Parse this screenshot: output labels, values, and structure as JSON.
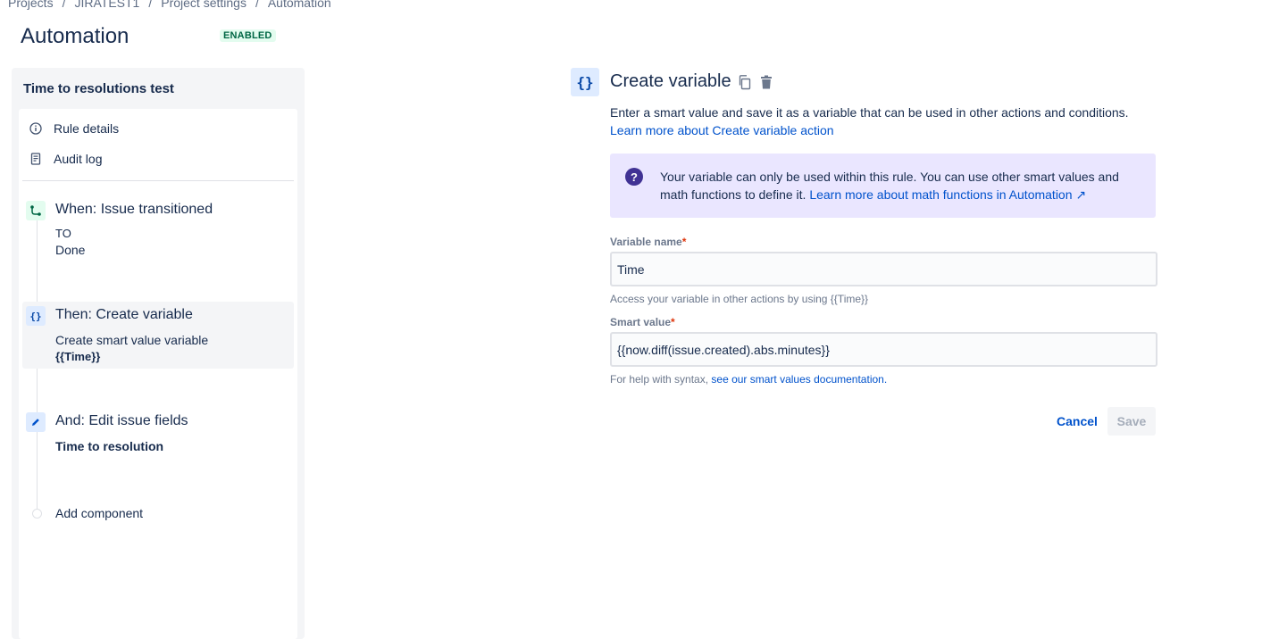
{
  "breadcrumb": [
    "Projects",
    "JIRATEST1",
    "Project settings",
    "Automation"
  ],
  "page": {
    "title": "Automation",
    "status_badge": "ENABLED"
  },
  "sidebar": {
    "rule_name": "Time to resolutions test",
    "menu": [
      {
        "label": "Rule details",
        "icon": "info-icon"
      },
      {
        "label": "Audit log",
        "icon": "document-icon"
      }
    ],
    "steps": [
      {
        "title": "When: Issue transitioned",
        "desc_line1": "TO",
        "desc_line2": "Done",
        "icon": "transition-icon",
        "selected": false
      },
      {
        "title": "Then: Create variable",
        "desc_line1": "Create smart value variable",
        "desc_line2": "{{Time}}",
        "icon": "braces-icon",
        "selected": true
      },
      {
        "title": "And: Edit issue fields",
        "desc_line1": "Time to resolution",
        "icon": "pencil-icon",
        "selected": false
      }
    ],
    "add_component": "Add component"
  },
  "detail": {
    "icon_text": "{}",
    "title": "Create variable",
    "description": "Enter a smart value and save it as a variable that can be used in other actions and conditions.",
    "description_link": "Learn more about Create variable action",
    "info_text": "Your variable can only be used within this rule. You can use other smart values and math functions to define it.",
    "info_link": "Learn more about math functions in Automation ↗",
    "variable_name": {
      "label": "Variable name",
      "required_mark": "*",
      "value": "Time",
      "help": "Access your variable in other actions by using {{Time}}"
    },
    "smart_value": {
      "label": "Smart value",
      "required_mark": "*",
      "value": "{{now.diff(issue.created).abs.minutes}}",
      "help_prefix": "For help with syntax,",
      "help_link": "see our smart values documentation."
    },
    "cancel_label": "Cancel",
    "save_label": "Save"
  },
  "colors": {
    "brand_link": "#0052cc",
    "text_primary": "#172b4d",
    "badge_bg": "#e3fcef",
    "badge_text": "#006644",
    "info_bg": "#eae6ff",
    "info_icon": "#403294",
    "selected_bg": "#f4f5f7"
  }
}
